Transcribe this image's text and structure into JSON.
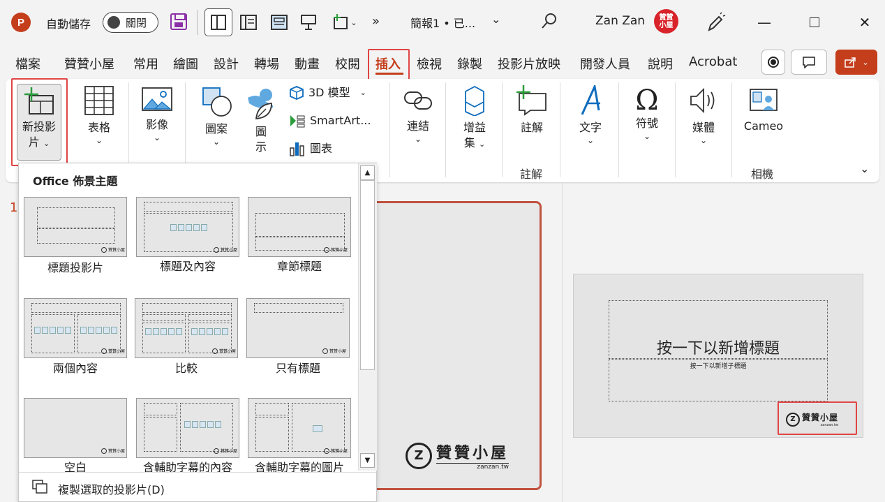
{
  "titlebar": {
    "logo_letter": "P",
    "autosave_label": "自動儲存",
    "toggle_label": "關閉",
    "more": "»",
    "doc_title": "簡報1 • 已...",
    "chevron": "⌄",
    "user_name": "Zan Zan",
    "avatar_text": "贊贊\n小屋",
    "minimize": "—",
    "close": "✕"
  },
  "tabs": [
    "檔案",
    "贊贊小屋",
    "常用",
    "繪圖",
    "設計",
    "轉場",
    "動畫",
    "校閱",
    "插入",
    "檢視",
    "錄製",
    "投影片放映",
    "開發人員",
    "說明",
    "Acrobat"
  ],
  "active_tab": "插入",
  "ribbon": {
    "new_slide": "新投影",
    "new_slide_2": "片",
    "table": "表格",
    "image": "影像",
    "shapes": "圖案",
    "icons_1": "圖",
    "icons_2": "示",
    "model3d": "3D 模型",
    "smartart": "SmartArt...",
    "chart": "圖表",
    "link": "連結",
    "addins_1": "增益",
    "addins_2": "集",
    "comment": "註解",
    "text": "文字",
    "symbol": "符號",
    "media": "媒體",
    "cameo": "Cameo",
    "group_comment": "註解",
    "group_camera": "相機"
  },
  "dropdown": {
    "title": "Office 佈景主題",
    "layouts": [
      "標題投影片",
      "標題及內容",
      "章節標題",
      "兩個內容",
      "比較",
      "只有標題",
      "空白",
      "含輔助字幕的內容",
      "含輔助字幕的圖片"
    ],
    "duplicate": "複製選取的投影片(D)",
    "scroll_up": "▲",
    "scroll_down": "▼"
  },
  "slide_number": "1",
  "slide": {
    "title_placeholder": "按一下以新增標題",
    "subtitle_placeholder": "按一下以新增子標題",
    "logo_text": "贊贊小屋",
    "logo_url": "zanzan.tw"
  },
  "colors": {
    "accent": "#c43e1c",
    "highlight": "#e04545",
    "ribbon_bg": "#ffffff"
  }
}
